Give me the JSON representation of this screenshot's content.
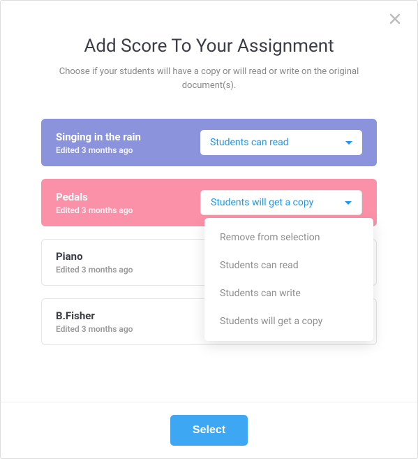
{
  "header": {
    "title": "Add Score To Your Assignment",
    "subtitle": "Choose if your students will have a copy or will read or write on the original document(s)."
  },
  "scores": [
    {
      "title": "Singing in the rain",
      "meta": "Edited 3 months ago",
      "selected": "Students can read",
      "variant": "purple",
      "dropdown_open": false
    },
    {
      "title": "Pedals",
      "meta": "Edited 3 months ago",
      "selected": "Students will get a copy",
      "variant": "pink",
      "dropdown_open": true
    },
    {
      "title": "Piano",
      "meta": "Edited 3 months ago",
      "selected": "",
      "variant": "plain",
      "dropdown_open": false
    },
    {
      "title": "B.Fisher",
      "meta": "Edited 3 months ago",
      "selected": "",
      "variant": "plain",
      "dropdown_open": false
    }
  ],
  "dropdown_options": [
    "Remove from selection",
    "Students can read",
    "Students can write",
    "Students will get a copy"
  ],
  "footer": {
    "select_label": "Select"
  },
  "icons": {
    "close": "close-icon"
  }
}
